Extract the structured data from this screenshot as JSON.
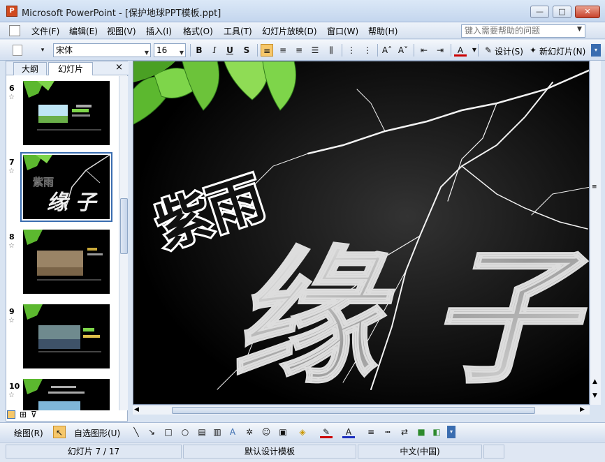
{
  "window": {
    "title": "Microsoft PowerPoint - [保护地球PPT模板.ppt]",
    "app_icon": "P",
    "minimize": "—",
    "maximize": "□",
    "close": "✕"
  },
  "menu": {
    "items": [
      "文件(F)",
      "编辑(E)",
      "视图(V)",
      "插入(I)",
      "格式(O)",
      "工具(T)",
      "幻灯片放映(D)",
      "窗口(W)",
      "帮助(H)"
    ],
    "help_placeholder": "键入需要帮助的问题"
  },
  "toolbar": {
    "font_name": "宋体",
    "font_size": "16",
    "bold": "B",
    "italic": "I",
    "underline": "U",
    "shadow": "S",
    "design_label": "设计(S)",
    "new_slide_label": "新幻灯片(N)"
  },
  "left_panel": {
    "tab_outline": "大纲",
    "tab_slides": "幻灯片",
    "close": "×",
    "thumbnails": [
      {
        "number": "6"
      },
      {
        "number": "7"
      },
      {
        "number": "8"
      },
      {
        "number": "9"
      },
      {
        "number": "10"
      }
    ]
  },
  "slide": {
    "title_text": "紫雨",
    "big_text": "缘 子"
  },
  "drawbar": {
    "draw_label": "绘图(R)",
    "autoshapes_label": "自选图形(U)"
  },
  "status": {
    "slide_pos": "幻灯片 7 / 17",
    "template": "默认设计模板",
    "language": "中文(中国)"
  },
  "colors": {
    "accent": "#3a6db0",
    "slide_bg": "#000000",
    "active_button": "#f6c76a"
  }
}
